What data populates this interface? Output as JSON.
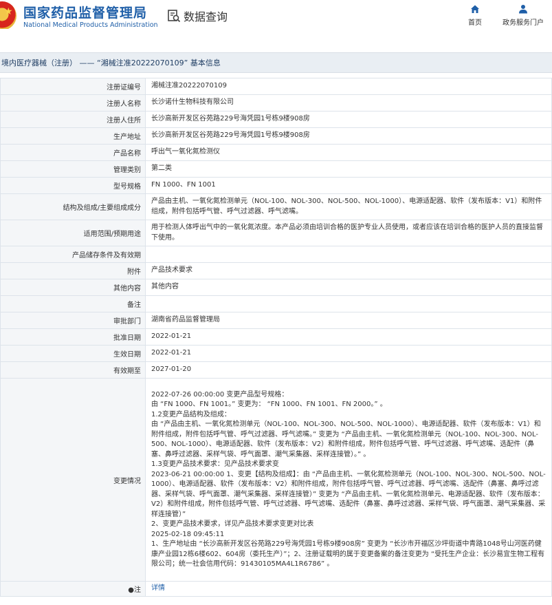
{
  "header": {
    "brand_cn": "国家药品监督管理局",
    "brand_en": "National Medical Products Administration",
    "query_label": "数据查询",
    "nav": {
      "home": "首页",
      "gov": "政务服务门户"
    },
    "colors": {
      "brand": "#1f5fa8",
      "title_bg": "#e9eef3",
      "key_bg": "#f4f6f8"
    },
    "icons": [
      "national-emblem-icon",
      "data-query-icon",
      "home-icon",
      "user-icon"
    ]
  },
  "breadcrumb": "境内医疗器械（注册） —— “湘械注准20222070109” 基本信息",
  "rows": [
    {
      "key": "注册证编号",
      "value": "湘械注准20222070109"
    },
    {
      "key": "注册人名称",
      "value": "长沙诺什生物科技有限公司"
    },
    {
      "key": "注册人住所",
      "value": "长沙高新开发区谷苑路229号海凭园1号栋9楼908房"
    },
    {
      "key": "生产地址",
      "value": "长沙高新开发区谷苑路229号海凭园1号栋9楼908房"
    },
    {
      "key": "产品名称",
      "value": "呼出气一氧化氮检测仪"
    },
    {
      "key": "管理类别",
      "value": "第二类"
    },
    {
      "key": "型号规格",
      "value": "FN 1000、FN 1001"
    },
    {
      "key": "结构及组成/主要组成成分",
      "value": "产品由主机、一氧化氮检测单元（NOL-100、NOL-300、NOL-500、NOL-1000）、电源适配器、软件（发布版本：V1）和附件组成，附件包括呼气管、呼气过滤器、呼气滤嘴。"
    },
    {
      "key": "适用范围/预期用途",
      "value": "用于检测人体呼出气中的一氧化氮浓度。本产品必须由培训合格的医护专业人员使用，或者应该在培训合格的医护人员的直接监督下使用。"
    },
    {
      "key": "产品储存条件及有效期",
      "value": ""
    },
    {
      "key": "附件",
      "value": "产品技术要求"
    },
    {
      "key": "其他内容",
      "value": "其他内容"
    },
    {
      "key": "备注",
      "value": ""
    },
    {
      "key": "审批部门",
      "value": "湖南省药品监督管理局"
    },
    {
      "key": "批准日期",
      "value": "2022-01-21"
    },
    {
      "key": "生效日期",
      "value": "2022-01-21"
    },
    {
      "key": "有效期至",
      "value": "2027-01-20"
    }
  ],
  "changes": {
    "key": "变更情况",
    "lines": [
      "2022-07-26 00:00:00 变更产品型号规格：",
      "由 “FN 1000、FN 1001。” 变更为： “FN 1000、FN 1001、FN 2000。” 。",
      "1.2变更产品结构及组成：",
      "由 “产品由主机、一氧化氮检测单元（NOL-100、NOL-300、NOL-500、NOL-1000）、电源适配器、软件（发布版本：V1）和附件组成，附件包括呼气管、呼气过滤器、呼气滤嘴。” 变更为 “产品由主机、一氧化氮检测单元（NOL-100、NOL-300、NOL-500、NOL-1000）、电源适配器、软件（发布版本：V2）和附件组成，附件包括呼气管、呼气过滤器、呼气滤嘴、选配件（鼻塞、鼻呼过滤器、采样气袋、呼气面罩、潮气采集器、采样连接管）。” 。",
      "1.3变更产品技术要求：见产品技术要求变",
      "2023-06-21 00:00:00 1、变更【结构及组成】：由 “产品由主机、一氧化氮检测单元（NOL-100、NOL-300、NOL-500、NOL-1000）、电源适配器、软件（发布版本：V2）和附件组成，附件包括呼气管、呼气过滤器、呼气滤嘴、选配件（鼻塞、鼻呼过滤器、采样气袋、呼气面罩、潮气采集器、采样连接管）” 变更为 “产品由主机、一氧化氮检测单元、电源适配器、软件（发布版本：V2）和附件组成，附件包括呼气管、呼气过滤器、呼气滤嘴、选配件（鼻塞、鼻呼过滤器、采样气袋、呼气面罩、潮气采集器、采样连接管）”",
      "2、变更产品技术要求，详见产品技术要求变更对比表",
      "2025-02-18 09:45:11",
      "1、生产地址由 “长沙高新开发区谷苑路229号海凭园1号栋9楼908房” 变更为 “长沙市开福区沙坪街道中青路1048号山河医药健康产业园12栋6楼602、604房（委托生产）”；2、注册证载明的属于变更备案的备注变更为 “受托生产企业：长沙易宜生物工程有限公司；统一社会信用代码：91430105MA4L1R6786” 。"
    ]
  },
  "note": {
    "key": "●注",
    "link": "详情"
  }
}
